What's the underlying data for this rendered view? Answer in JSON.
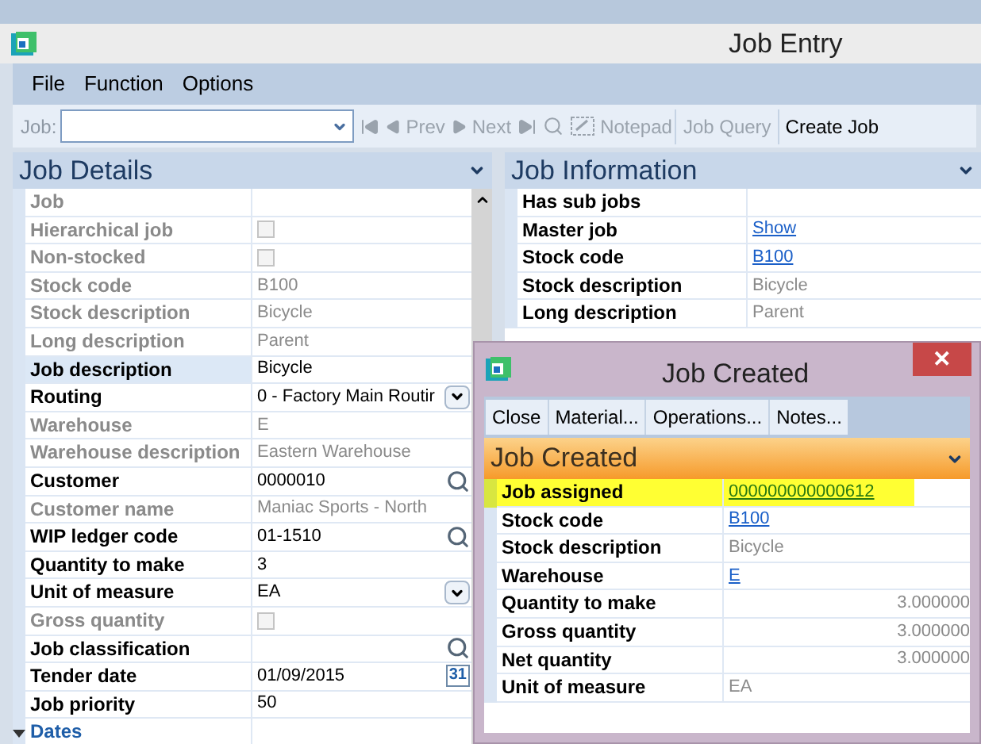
{
  "window": {
    "title": "Job Entry"
  },
  "menu": [
    "File",
    "Function",
    "Options"
  ],
  "toolbar": {
    "job_label": "Job:",
    "buttons": [
      {
        "kind": "first",
        "disabled": true
      },
      {
        "kind": "prev",
        "label": "Prev",
        "disabled": true
      },
      {
        "kind": "next",
        "label": "Next",
        "disabled": true
      },
      {
        "kind": "last",
        "disabled": true
      },
      {
        "kind": "search",
        "disabled": true
      },
      {
        "kind": "notepad",
        "label": "Notepad",
        "disabled": true
      },
      {
        "kind": "text",
        "label": "Job Query",
        "disabled": true
      },
      {
        "kind": "text",
        "label": "Create Job",
        "disabled": false
      }
    ]
  },
  "job_details": {
    "title": "Job Details",
    "rows": [
      {
        "label": "Job",
        "kind": "text",
        "disabled": true,
        "selected": false
      },
      {
        "label": "Hierarchical job",
        "kind": "checkbox",
        "checked": false,
        "disabled": true,
        "selected": false
      },
      {
        "label": "Non-stocked",
        "kind": "checkbox",
        "checked": false,
        "disabled": true,
        "selected": false
      },
      {
        "label": "Stock code",
        "value": "B100",
        "kind": "text",
        "disabled": true,
        "selected": false
      },
      {
        "label": "Stock description",
        "value": "Bicycle",
        "kind": "text",
        "disabled": true,
        "selected": false
      },
      {
        "label": "Long description",
        "value": "Parent",
        "kind": "text",
        "disabled": true,
        "selected": false
      },
      {
        "label": "Job description",
        "value": "Bicycle",
        "kind": "text",
        "disabled": false,
        "selected": true
      },
      {
        "label": "Routing",
        "value": "0 - Factory Main Routir",
        "kind": "dropdown",
        "disabled": false,
        "selected": false
      },
      {
        "label": "Warehouse",
        "value": "E",
        "kind": "text",
        "disabled": true,
        "selected": false
      },
      {
        "label": "Warehouse description",
        "value": "Eastern Warehouse",
        "kind": "text",
        "disabled": true,
        "selected": false
      },
      {
        "label": "Customer",
        "value": "0000010",
        "kind": "search",
        "disabled": false,
        "selected": false
      },
      {
        "label": "Customer name",
        "value": "Maniac Sports - North",
        "kind": "text",
        "disabled": true,
        "selected": false
      },
      {
        "label": "WIP ledger code",
        "value": "01-1510",
        "kind": "search",
        "disabled": false,
        "selected": false
      },
      {
        "label": "Quantity to make",
        "value": "3",
        "kind": "text",
        "disabled": false,
        "selected": false
      },
      {
        "label": "Unit of measure",
        "value": "EA",
        "kind": "dropdown",
        "disabled": false,
        "selected": false
      },
      {
        "label": "Gross quantity",
        "kind": "checkbox",
        "checked": false,
        "disabled": true,
        "selected": false
      },
      {
        "label": "Job classification",
        "kind": "search",
        "disabled": false,
        "selected": false
      },
      {
        "label": "Tender date",
        "value": "01/09/2015",
        "kind": "date",
        "date_icon": "31",
        "disabled": false,
        "selected": false
      },
      {
        "label": "Job priority",
        "value": "50",
        "kind": "text",
        "disabled": false,
        "selected": false
      },
      {
        "label": "Dates",
        "kind": "group",
        "expanded": true
      }
    ]
  },
  "job_information": {
    "title": "Job Information",
    "rows": [
      {
        "label": "Has sub jobs"
      },
      {
        "label": "Master job",
        "value": "Show",
        "link": true
      },
      {
        "label": "Stock code",
        "value": "B100",
        "link": true
      },
      {
        "label": "Stock description",
        "value": "Bicycle",
        "link": false
      },
      {
        "label": "Long description",
        "value": "Parent",
        "link": false
      }
    ]
  },
  "dialog": {
    "title": "Job Created",
    "close": "✕",
    "toolbar": [
      "Close",
      "Material...",
      "Operations...",
      "Notes..."
    ],
    "section": "Job Created",
    "rows": [
      {
        "label": "Job assigned",
        "value": "000000000000612",
        "kind": "link",
        "highlighted": true
      },
      {
        "label": "Stock code",
        "value": "B100",
        "kind": "link",
        "highlighted": false
      },
      {
        "label": "Stock description",
        "value": "Bicycle",
        "kind": "text",
        "highlighted": false
      },
      {
        "label": "Warehouse",
        "value": "E",
        "kind": "link",
        "highlighted": false
      },
      {
        "label": "Quantity to make",
        "value": "3.000000",
        "kind": "number",
        "highlighted": false
      },
      {
        "label": "Gross quantity",
        "value": "3.000000",
        "kind": "number",
        "highlighted": false
      },
      {
        "label": "Net quantity",
        "value": "3.000000",
        "kind": "number",
        "highlighted": false
      },
      {
        "label": "Unit of measure",
        "value": "EA",
        "kind": "text",
        "highlighted": false
      }
    ]
  }
}
